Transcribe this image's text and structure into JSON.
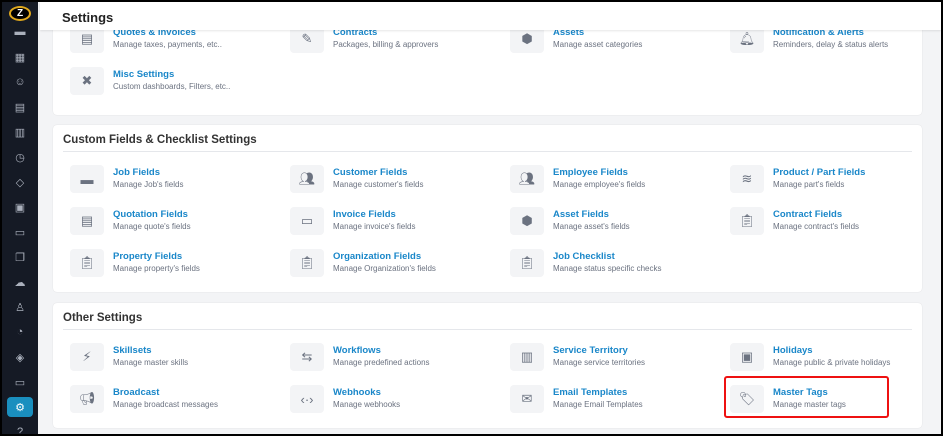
{
  "header": {
    "title": "Settings"
  },
  "sidebar": {
    "logo": "Z",
    "icons": [
      "briefcase-icon",
      "calendar-icon",
      "users-icon",
      "document-icon",
      "map-icon",
      "clock-icon",
      "tag-icon",
      "id-card-icon",
      "folder-icon",
      "copy-icon",
      "coins-icon",
      "user-icon",
      "palette-icon",
      "layers-icon",
      "monitor-icon",
      "gear-icon",
      "help-icon"
    ],
    "active": "gear-icon"
  },
  "sections": [
    {
      "title": "",
      "items": [
        {
          "icon": "document-icon",
          "glyph": "▤",
          "title": "Quotes & Invoices",
          "desc": "Manage taxes, payments, etc.."
        },
        {
          "icon": "edit-icon",
          "glyph": "✎",
          "title": "Contracts",
          "desc": "Packages, billing & approvers"
        },
        {
          "icon": "cube-icon",
          "glyph": "⬢",
          "title": "Assets",
          "desc": "Manage asset categories"
        },
        {
          "icon": "bell-icon",
          "glyph": "🔔︎",
          "title": "Notification & Alerts",
          "desc": "Reminders, delay & status alerts"
        },
        {
          "icon": "tools-icon",
          "glyph": "✖",
          "title": "Misc Settings",
          "desc": "Custom dashboards, Filters, etc.."
        }
      ]
    },
    {
      "title": "Custom Fields & Checklist Settings",
      "items": [
        {
          "icon": "briefcase-icon",
          "glyph": "▬",
          "title": "Job Fields",
          "desc": "Manage Job's fields"
        },
        {
          "icon": "users-icon",
          "glyph": "👥︎",
          "title": "Customer Fields",
          "desc": "Manage customer's fields"
        },
        {
          "icon": "users-icon",
          "glyph": "👥︎",
          "title": "Employee Fields",
          "desc": "Manage employee's fields"
        },
        {
          "icon": "layers-icon",
          "glyph": "≋",
          "title": "Product / Part Fields",
          "desc": "Manage part's fields"
        },
        {
          "icon": "document-icon",
          "glyph": "▤",
          "title": "Quotation Fields",
          "desc": "Manage quote's fields"
        },
        {
          "icon": "invoice-icon",
          "glyph": "▭",
          "title": "Invoice Fields",
          "desc": "Manage invoice's fields"
        },
        {
          "icon": "cube-icon",
          "glyph": "⬢",
          "title": "Asset Fields",
          "desc": "Manage asset's fields"
        },
        {
          "icon": "clipboard-icon",
          "glyph": "📋︎",
          "title": "Contract Fields",
          "desc": "Manage contract's fields"
        },
        {
          "icon": "clipboard-icon",
          "glyph": "📋︎",
          "title": "Property Fields",
          "desc": "Manage property's fields"
        },
        {
          "icon": "clipboard-icon",
          "glyph": "📋︎",
          "title": "Organization Fields",
          "desc": "Manage Organization's fields"
        },
        {
          "icon": "checklist-icon",
          "glyph": "📋︎",
          "title": "Job Checklist",
          "desc": "Manage status specific checks"
        }
      ]
    },
    {
      "title": "Other Settings",
      "items": [
        {
          "icon": "bolt-icon",
          "glyph": "⚡︎",
          "title": "Skillsets",
          "desc": "Manage master skills"
        },
        {
          "icon": "arrows-icon",
          "glyph": "⇆",
          "title": "Workflows",
          "desc": "Manage predefined actions"
        },
        {
          "icon": "map-icon",
          "glyph": "▥",
          "title": "Service Territory",
          "desc": "Manage service territories"
        },
        {
          "icon": "wallet-icon",
          "glyph": "▣",
          "title": "Holidays",
          "desc": "Manage public & private holidays"
        },
        {
          "icon": "megaphone-icon",
          "glyph": "📢︎",
          "title": "Broadcast",
          "desc": "Manage broadcast messages"
        },
        {
          "icon": "code-icon",
          "glyph": "‹·›",
          "title": "Webhooks",
          "desc": "Manage webhooks"
        },
        {
          "icon": "envelope-icon",
          "glyph": "✉",
          "title": "Email Templates",
          "desc": "Manage Email Templates"
        },
        {
          "icon": "tag-icon",
          "glyph": "🏷︎",
          "title": "Master Tags",
          "desc": "Manage master tags"
        }
      ]
    }
  ]
}
